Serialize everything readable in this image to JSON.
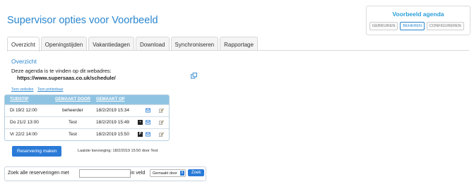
{
  "header": {
    "title": "Supervisor opties voor Voorbeeld",
    "agenda_title": "Voorbeeld agenda",
    "mode_buttons": [
      "GEBRUIKEN",
      "BEHEREN",
      "CONFIGUREREN"
    ]
  },
  "tabs": [
    "Overzicht",
    "Openingstijden",
    "Vakantiedagen",
    "Download",
    "Synchroniseren",
    "Rapportage"
  ],
  "overview": {
    "title": "Overzicht",
    "info_text": "Deze agenda is te vinden op dit webadres:",
    "url": "https://www.supersaas.co.uk/schedule/",
    "link_past": "Toon verleden",
    "link_print": "Toon printerbaar"
  },
  "table": {
    "headers": [
      "TIJDSTIP",
      "GEMAAKT DOOR",
      "GEMAAKT OP"
    ],
    "rows": [
      {
        "time": "Di 19/2 12:00",
        "by": "beheerder",
        "on": "18/2/2019 15:34",
        "badge": ""
      },
      {
        "time": "Do 21/2 13:00",
        "by": "Test",
        "on": "18/2/2019 15:49",
        "badge": "▪"
      },
      {
        "time": "Vr 22/2 14:00",
        "by": "Test",
        "on": "18/2/2019 15:50",
        "badge": "P"
      }
    ]
  },
  "actions": {
    "make_reservation": "Reservering maken",
    "last_added": "Laatste toevoeging: 18/2/2019 15:50 door Test"
  },
  "search": {
    "label": "Zoek alle reserveringen met",
    "input_value": "",
    "field_label": "in veld",
    "field_selected": "Gemaakt door",
    "button": "Zoek"
  },
  "colors": {
    "title_blue": "#2a86cf",
    "table_header": "#8fc3e2",
    "button_blue": "#2a7bd8"
  }
}
